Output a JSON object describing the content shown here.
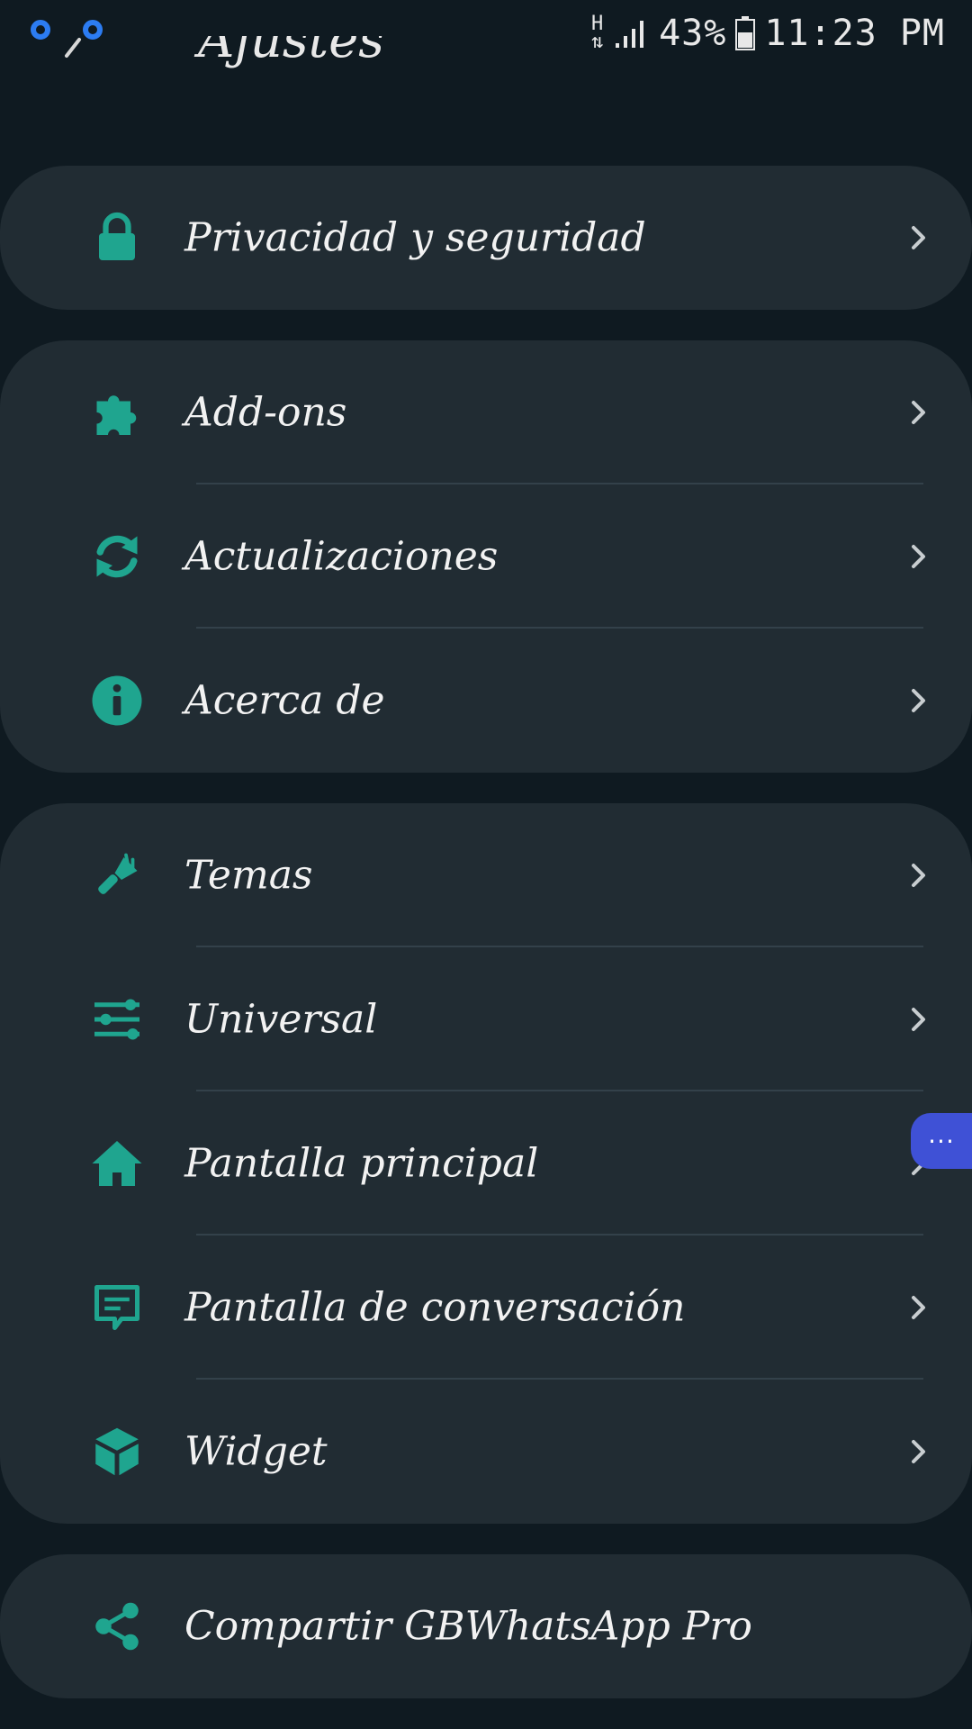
{
  "status_bar": {
    "network_type": "H",
    "battery_percent": "43%",
    "time": "11:23 PM"
  },
  "header": {
    "title": "Ajustes"
  },
  "colors": {
    "accent": "#1fa58f",
    "background": "#0f1a21",
    "card": "#212c33",
    "chevron": "#c8cdd0",
    "bubble": "#3f51d6"
  },
  "groups": [
    {
      "items": [
        {
          "label": "Privacidad y seguridad",
          "icon": "lock-icon"
        }
      ]
    },
    {
      "items": [
        {
          "label": "Add-ons",
          "icon": "puzzle-icon"
        },
        {
          "label": "Actualizaciones",
          "icon": "refresh-icon"
        },
        {
          "label": "Acerca de",
          "icon": "info-icon"
        }
      ]
    },
    {
      "items": [
        {
          "label": "Temas",
          "icon": "paint-brush-icon"
        },
        {
          "label": "Universal",
          "icon": "sliders-icon"
        },
        {
          "label": "Pantalla principal",
          "icon": "home-icon"
        },
        {
          "label": "Pantalla de conversación",
          "icon": "chat-icon"
        },
        {
          "label": "Widget",
          "icon": "cube-icon"
        }
      ]
    },
    {
      "items": [
        {
          "label": "Compartir GBWhatsApp Pro",
          "icon": "share-icon"
        }
      ]
    }
  ],
  "floating_bubble": {
    "label": "···"
  }
}
